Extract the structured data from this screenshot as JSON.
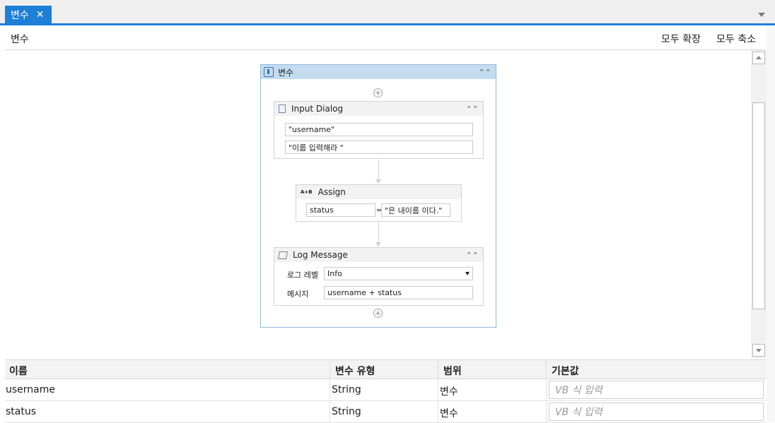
{
  "tab": {
    "label": "변수",
    "close": "✕"
  },
  "header": {
    "title": "변수",
    "expand_all": "모두 확장",
    "collapse_all": "모두 축소"
  },
  "sequence": {
    "title": "변수",
    "input_dialog": {
      "title": "Input Dialog",
      "field1": "\"username\"",
      "field2": "\"이름 입력해라 \""
    },
    "assign": {
      "icon_text": "A+B",
      "title": "Assign",
      "left": "status",
      "eq": "=",
      "right": "\"은 내이름 이다.\""
    },
    "log_message": {
      "title": "Log Message",
      "level_label": "로그 레벨",
      "level_value": "Info",
      "message_label": "메시지",
      "message_value": "username + status"
    }
  },
  "variables": {
    "columns": [
      "이름",
      "변수 유형",
      "범위",
      "기본값"
    ],
    "rows": [
      {
        "name": "username",
        "type": "String",
        "scope": "변수",
        "default_placeholder": "VB 식 입력"
      },
      {
        "name": "status",
        "type": "String",
        "scope": "변수",
        "default_placeholder": "VB 식 입력"
      }
    ]
  }
}
